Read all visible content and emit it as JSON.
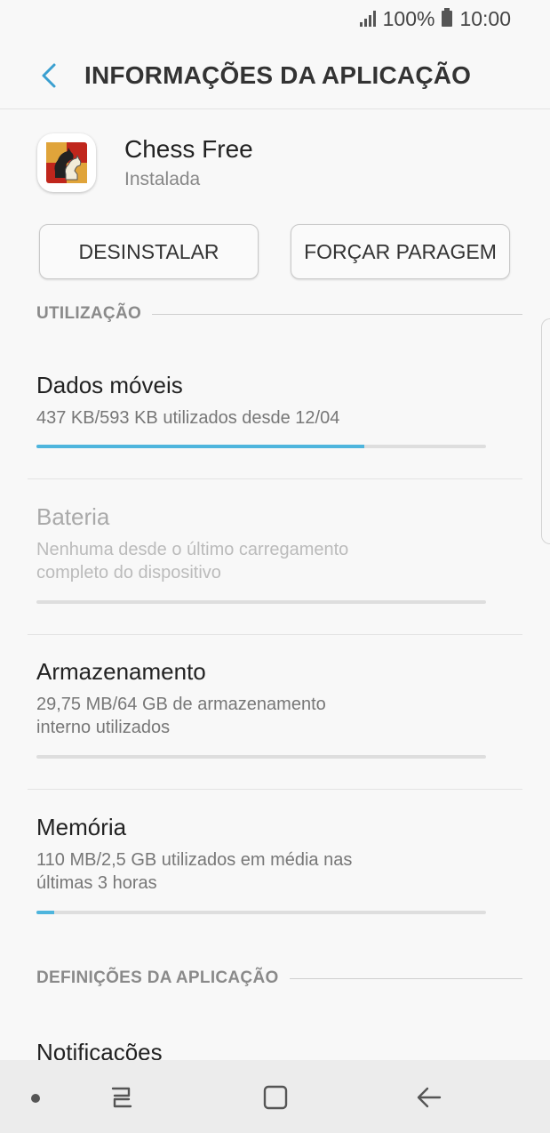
{
  "status_bar": {
    "battery": "100%",
    "time": "10:00"
  },
  "app_bar": {
    "title": "INFORMAÇÕES DA APLICAÇÃO"
  },
  "app": {
    "name": "Chess Free",
    "status": "Instalada"
  },
  "buttons": {
    "uninstall": "DESINSTALAR",
    "force_stop": "FORÇAR PARAGEM"
  },
  "usage": {
    "header": "UTILIZAÇÃO",
    "mobile_data": {
      "title": "Dados móveis",
      "subtitle": "437 KB/593 KB utilizados desde 12/04",
      "progress": 0.73
    },
    "battery": {
      "title": "Bateria",
      "subtitle_1": "Nenhuma desde o último carregamento",
      "subtitle_2": "completo do dispositivo",
      "progress": 0
    },
    "storage": {
      "title": "Armazenamento",
      "subtitle_1": "29,75 MB/64 GB de armazenamento",
      "subtitle_2": "interno utilizados",
      "progress": 0
    },
    "memory": {
      "title": "Memória",
      "subtitle_1": "110 MB/2,5 GB utilizados em média nas",
      "subtitle_2": "últimas 3 horas",
      "progress": 0.04
    }
  },
  "app_settings": {
    "header": "DEFINIÇÕES DA APLICAÇÃO",
    "notifications": "Notificações"
  },
  "colors": {
    "accent": "#4eb5dd"
  }
}
